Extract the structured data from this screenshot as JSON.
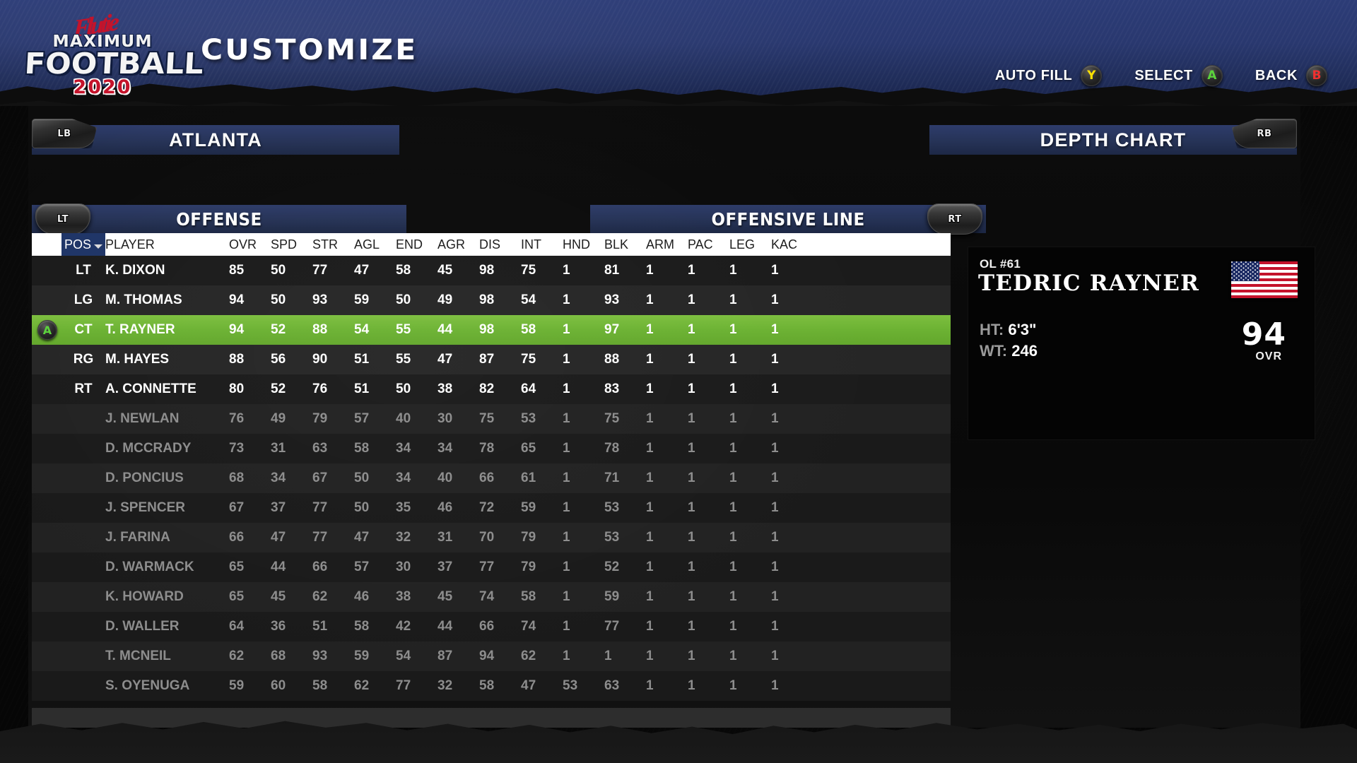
{
  "app": {
    "logo_signature": "Doug Flutie",
    "logo_line1": "MAXIMUM",
    "logo_line2": "FOOTBALL",
    "logo_year": "2020",
    "screen_title": "CUSTOMIZE"
  },
  "prompts": [
    {
      "label": "AUTO FILL",
      "button": "Y",
      "color": "#ffe100"
    },
    {
      "label": "SELECT",
      "button": "A",
      "color": "#5bd23c"
    },
    {
      "label": "BACK",
      "button": "B",
      "color": "#f03030"
    }
  ],
  "headers": {
    "team": "ATLANTA",
    "depth_chart": "DEPTH CHART",
    "left_bumper": "LB",
    "right_bumper": "RB"
  },
  "tabs": {
    "offense": "OFFENSE",
    "offensive_line": "OFFENSIVE LINE",
    "left_trigger": "LT",
    "right_trigger": "RT"
  },
  "table": {
    "columns": [
      "POS",
      "PLAYER",
      "OVR",
      "SPD",
      "STR",
      "AGL",
      "END",
      "AGR",
      "DIS",
      "INT",
      "HND",
      "BLK",
      "ARM",
      "PAC",
      "LEG",
      "KAC"
    ],
    "sorted_by": "POS",
    "sort_direction": "descending",
    "selected_index": 2,
    "select_badge": "A",
    "rows": [
      {
        "pos": "LT",
        "player": "K. DIXON",
        "stats": [
          "85",
          "50",
          "77",
          "47",
          "58",
          "45",
          "98",
          "75",
          "1",
          "81",
          "1",
          "1",
          "1",
          "1"
        ],
        "starter": true,
        "selected": false
      },
      {
        "pos": "LG",
        "player": "M. THOMAS",
        "stats": [
          "94",
          "50",
          "93",
          "59",
          "50",
          "49",
          "98",
          "54",
          "1",
          "93",
          "1",
          "1",
          "1",
          "1"
        ],
        "starter": true,
        "selected": false
      },
      {
        "pos": "CT",
        "player": "T. RAYNER",
        "stats": [
          "94",
          "52",
          "88",
          "54",
          "55",
          "44",
          "98",
          "58",
          "1",
          "97",
          "1",
          "1",
          "1",
          "1"
        ],
        "starter": true,
        "selected": true
      },
      {
        "pos": "RG",
        "player": "M. HAYES",
        "stats": [
          "88",
          "56",
          "90",
          "51",
          "55",
          "47",
          "87",
          "75",
          "1",
          "88",
          "1",
          "1",
          "1",
          "1"
        ],
        "starter": true,
        "selected": false
      },
      {
        "pos": "RT",
        "player": "A. CONNETTE",
        "stats": [
          "80",
          "52",
          "76",
          "51",
          "50",
          "38",
          "82",
          "64",
          "1",
          "83",
          "1",
          "1",
          "1",
          "1"
        ],
        "starter": true,
        "selected": false
      },
      {
        "pos": "",
        "player": "J. NEWLAN",
        "stats": [
          "76",
          "49",
          "79",
          "57",
          "40",
          "30",
          "75",
          "53",
          "1",
          "75",
          "1",
          "1",
          "1",
          "1"
        ],
        "starter": false,
        "selected": false
      },
      {
        "pos": "",
        "player": "D. MCCRADY",
        "stats": [
          "73",
          "31",
          "63",
          "58",
          "34",
          "34",
          "78",
          "65",
          "1",
          "78",
          "1",
          "1",
          "1",
          "1"
        ],
        "starter": false,
        "selected": false
      },
      {
        "pos": "",
        "player": "D. PONCIUS",
        "stats": [
          "68",
          "34",
          "67",
          "50",
          "34",
          "40",
          "66",
          "61",
          "1",
          "71",
          "1",
          "1",
          "1",
          "1"
        ],
        "starter": false,
        "selected": false
      },
      {
        "pos": "",
        "player": "J. SPENCER",
        "stats": [
          "67",
          "37",
          "77",
          "50",
          "35",
          "46",
          "72",
          "59",
          "1",
          "53",
          "1",
          "1",
          "1",
          "1"
        ],
        "starter": false,
        "selected": false
      },
      {
        "pos": "",
        "player": "J. FARINA",
        "stats": [
          "66",
          "47",
          "77",
          "47",
          "32",
          "31",
          "70",
          "79",
          "1",
          "53",
          "1",
          "1",
          "1",
          "1"
        ],
        "starter": false,
        "selected": false
      },
      {
        "pos": "",
        "player": "D. WARMACK",
        "stats": [
          "65",
          "44",
          "66",
          "57",
          "30",
          "37",
          "77",
          "79",
          "1",
          "52",
          "1",
          "1",
          "1",
          "1"
        ],
        "starter": false,
        "selected": false
      },
      {
        "pos": "",
        "player": "K. HOWARD",
        "stats": [
          "65",
          "45",
          "62",
          "46",
          "38",
          "45",
          "74",
          "58",
          "1",
          "59",
          "1",
          "1",
          "1",
          "1"
        ],
        "starter": false,
        "selected": false
      },
      {
        "pos": "",
        "player": "D. WALLER",
        "stats": [
          "64",
          "36",
          "51",
          "58",
          "42",
          "44",
          "66",
          "74",
          "1",
          "77",
          "1",
          "1",
          "1",
          "1"
        ],
        "starter": false,
        "selected": false
      },
      {
        "pos": "",
        "player": "T. MCNEIL",
        "stats": [
          "62",
          "68",
          "93",
          "59",
          "54",
          "87",
          "94",
          "62",
          "1",
          "1",
          "1",
          "1",
          "1",
          "1"
        ],
        "starter": false,
        "selected": false
      },
      {
        "pos": "",
        "player": "S. OYENUGA",
        "stats": [
          "59",
          "60",
          "58",
          "62",
          "77",
          "32",
          "58",
          "47",
          "53",
          "63",
          "1",
          "1",
          "1",
          "1"
        ],
        "starter": false,
        "selected": false
      }
    ]
  },
  "player_card": {
    "position_number": "OL #61",
    "name": "TEDRIC RAYNER",
    "height_key": "HT:",
    "height_value": "6'3\"",
    "weight_key": "WT:",
    "weight_value": "246",
    "overall": "94",
    "overall_label": "OVR",
    "nationality_flag": "usa-flag"
  },
  "colors": {
    "banner_blue": "#29386f",
    "bar_blue": "#263357",
    "selected_green": "#6cb233",
    "accent_red": "#c4132b"
  }
}
